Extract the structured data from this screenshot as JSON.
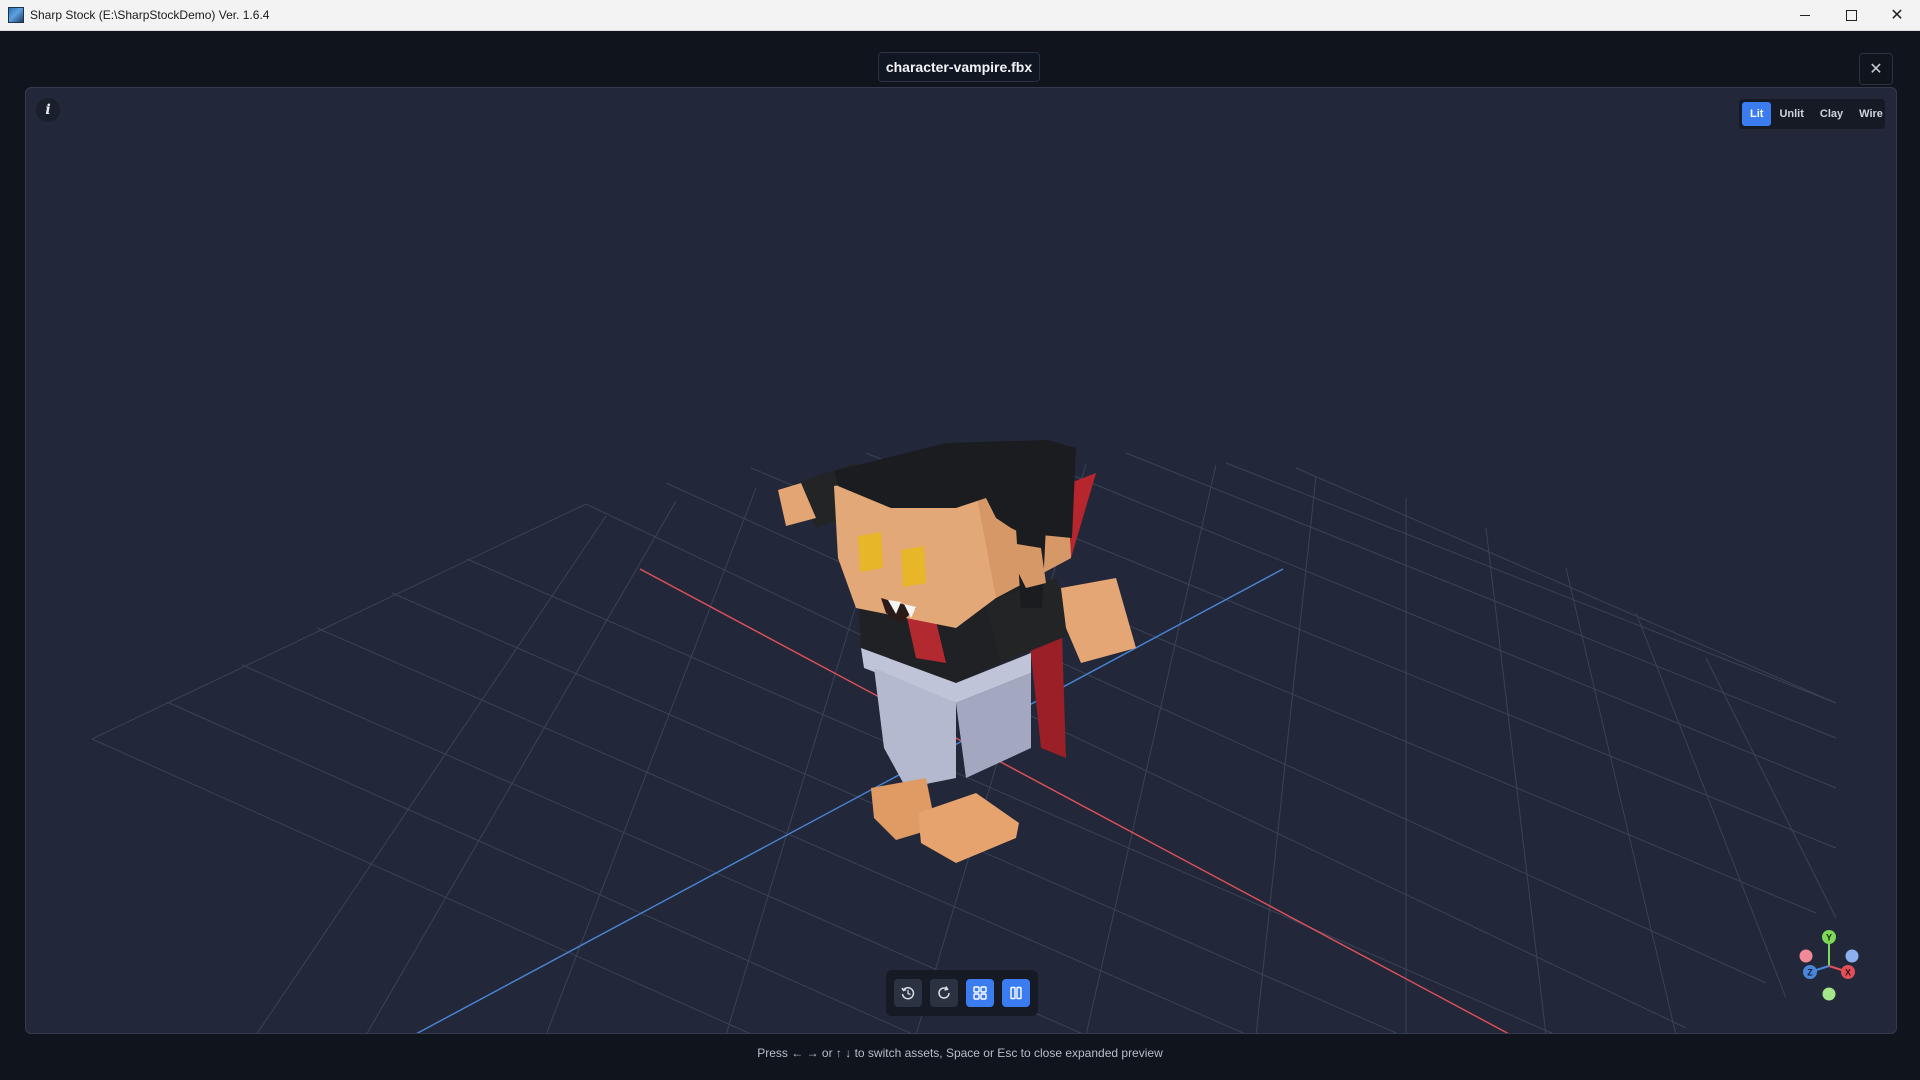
{
  "window": {
    "title": "Sharp Stock (E:\\SharpStockDemo) Ver. 1.6.4",
    "controls": [
      "minimize-icon",
      "maximize-icon",
      "close-icon"
    ]
  },
  "preview": {
    "filename": "character-vampire.fbx",
    "close_glyph": "✕",
    "info_glyph": "i",
    "render_modes": [
      {
        "label": "Lit",
        "active": true
      },
      {
        "label": "Unlit",
        "active": false
      },
      {
        "label": "Clay",
        "active": false
      },
      {
        "label": "Wire",
        "active": false
      }
    ],
    "toolbar": [
      {
        "name": "reset-view-icon",
        "active": false
      },
      {
        "name": "rotate-icon",
        "active": false
      },
      {
        "name": "grid-icon",
        "active": true
      },
      {
        "name": "pause-icon",
        "active": true
      }
    ],
    "axis_gizmo": {
      "x": "X",
      "y": "Y",
      "z": "Z"
    },
    "hint": "Press ← → or ↑ ↓ to switch assets, Space or Esc to close expanded preview"
  },
  "colors": {
    "accent": "#3b7cf0",
    "x_axis": "#e0505a",
    "z_axis": "#4a86d8",
    "y_axis": "#7ed957"
  }
}
